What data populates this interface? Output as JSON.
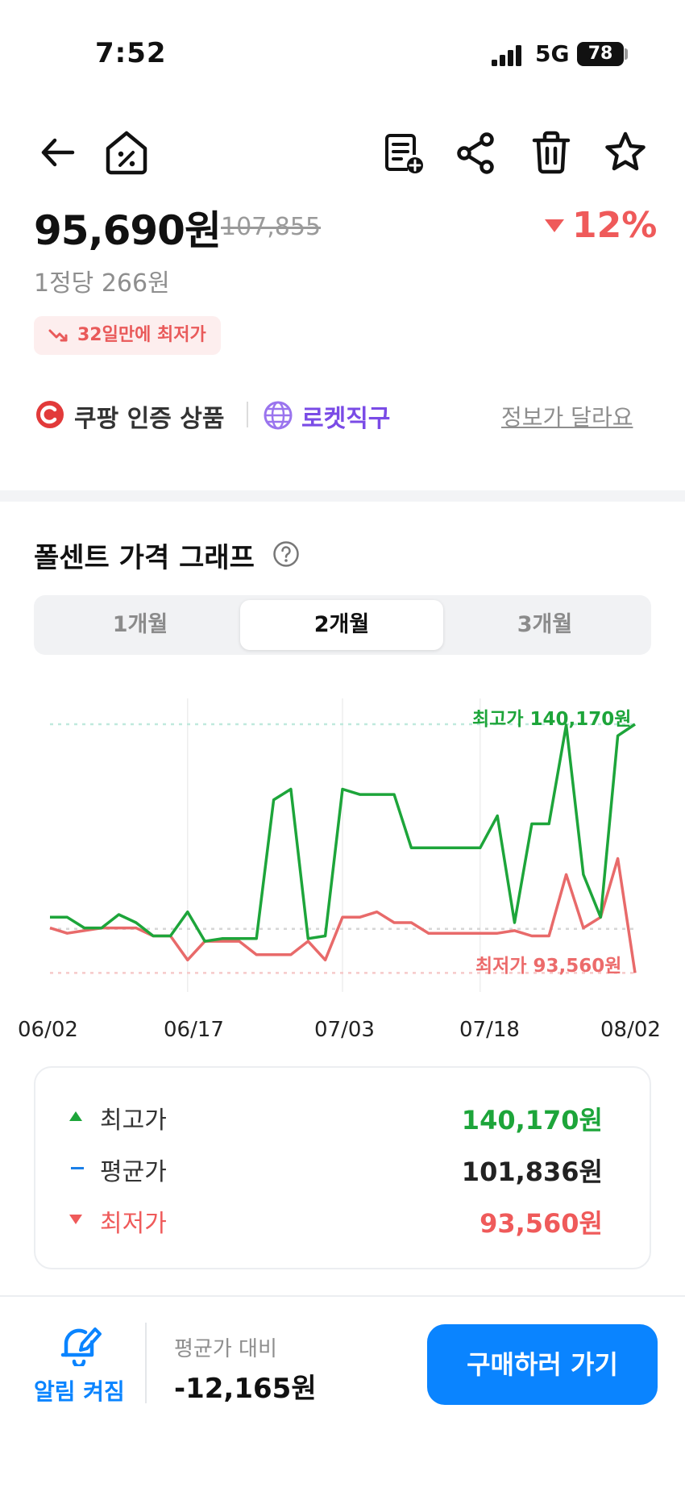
{
  "status_bar": {
    "time": "7:52",
    "network": "5G",
    "battery": "78"
  },
  "header": {
    "icons": [
      "back-arrow-icon",
      "price-tag-home-icon",
      "add-list-icon",
      "share-icon",
      "trash-icon",
      "star-icon"
    ]
  },
  "product": {
    "price": "95,690원",
    "original_price": "107,855",
    "discount": "12%",
    "unit_price": "1정당 266원",
    "badge": "32일만에 최저가",
    "certified": "쿠팡 인증 상품",
    "rocket": "로켓직구",
    "report_link": "정보가 달라요"
  },
  "graph": {
    "title": "폴센트 가격 그래프",
    "tabs": [
      {
        "label": "1개월",
        "active": false
      },
      {
        "label": "2개월",
        "active": true
      },
      {
        "label": "3개월",
        "active": false
      }
    ],
    "high_label": "최고가 140,170원",
    "low_label": "최저가 93,560원",
    "x_ticks": [
      "06/02",
      "06/17",
      "07/03",
      "07/18",
      "08/02"
    ]
  },
  "chart_data": {
    "type": "line",
    "x": [
      "06/02",
      "06/04",
      "06/06",
      "06/08",
      "06/10",
      "06/12",
      "06/14",
      "06/16",
      "06/17",
      "06/18",
      "06/20",
      "06/22",
      "06/24",
      "06/26",
      "06/28",
      "06/30",
      "07/02",
      "07/03",
      "07/04",
      "07/06",
      "07/08",
      "07/10",
      "07/12",
      "07/14",
      "07/16",
      "07/18",
      "07/19",
      "07/20",
      "07/22",
      "07/24",
      "07/26",
      "07/28",
      "07/30",
      "08/01",
      "08/02"
    ],
    "series": [
      {
        "name": "최고가",
        "color": "#1da53a",
        "values": [
          104000,
          104000,
          102000,
          102000,
          104500,
          103000,
          100500,
          100500,
          105000,
          99500,
          100000,
          100000,
          100000,
          126000,
          128000,
          100000,
          100500,
          128000,
          127000,
          127000,
          127000,
          117000,
          117000,
          117000,
          117000,
          117000,
          123000,
          103000,
          121500,
          121500,
          140000,
          112000,
          104000,
          138000,
          140170
        ]
      },
      {
        "name": "최저가",
        "color": "#e86a6a",
        "values": [
          102000,
          101000,
          101500,
          102000,
          102000,
          102000,
          100500,
          100500,
          96000,
          99500,
          99500,
          99500,
          97000,
          97000,
          97000,
          99500,
          96000,
          104000,
          104000,
          105000,
          103000,
          103000,
          101000,
          101000,
          101000,
          101000,
          101000,
          101500,
          100500,
          100500,
          112000,
          102000,
          104000,
          115000,
          93560
        ]
      }
    ],
    "average": 101836,
    "ylim": [
      90000,
      145000
    ],
    "grid": false
  },
  "summary": {
    "rows": [
      {
        "label": "최고가",
        "value": "140,170원",
        "color": "#1da53a"
      },
      {
        "label": "평균가",
        "value": "101,836원",
        "color": "#222222"
      },
      {
        "label": "최저가",
        "value": "93,560원",
        "color": "#ef5a5a"
      }
    ]
  },
  "bottom": {
    "alarm_label": "알림 켜짐",
    "compare_label": "평균가 대비",
    "compare_value": "-12,165원",
    "buy_label": "구매하러 가기"
  }
}
